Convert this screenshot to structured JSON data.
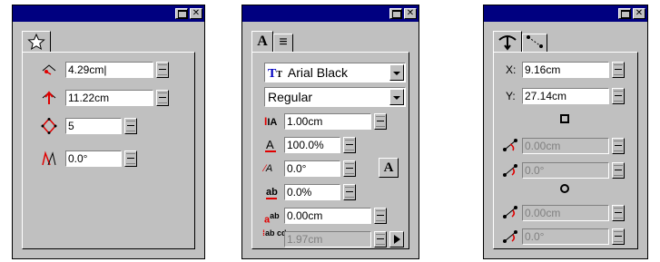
{
  "window_controls": {
    "minimize": "minimize",
    "close": "✕"
  },
  "star_panel": {
    "tab_icon": "star-icon",
    "fields": [
      {
        "icon": "star-inner-radius-icon",
        "value": "4.29cm|"
      },
      {
        "icon": "star-outer-radius-icon",
        "value": "11.22cm"
      },
      {
        "icon": "star-points-icon",
        "value": "5"
      },
      {
        "icon": "star-angle-icon",
        "value": "0.0°"
      }
    ]
  },
  "text_panel": {
    "tabs": [
      {
        "label": "A"
      },
      {
        "label": "≡"
      }
    ],
    "font_name": "Arial Black",
    "font_style": "Regular",
    "fields": [
      {
        "icon": "font-size-icon",
        "label": "IA",
        "value": "1.00cm",
        "disabled": false
      },
      {
        "icon": "horizontal-scale-icon",
        "label": "A",
        "value": "100.0%",
        "disabled": false
      },
      {
        "icon": "slant-angle-icon",
        "label": "A",
        "value": "0.0°",
        "disabled": false
      },
      {
        "icon": "character-spacing-icon",
        "label": "ab",
        "value": "0.0%",
        "disabled": false
      },
      {
        "icon": "baseline-shift-icon",
        "label": "ab",
        "value": "0.00cm",
        "disabled": false
      },
      {
        "icon": "line-spacing-icon",
        "label": "ab cd",
        "value": "1.97cm",
        "disabled": true
      }
    ],
    "font_button_label": "A"
  },
  "point_panel": {
    "tab_icons": [
      "node-edit-icon",
      "control-points-icon"
    ],
    "x_label": "X:",
    "x_value": "9.16cm",
    "y_label": "Y:",
    "y_value": "27.14cm",
    "handle_fields": [
      {
        "value": "0.00cm"
      },
      {
        "value": "0.0°"
      },
      {
        "value": "0.00cm"
      },
      {
        "value": "0.0°"
      }
    ]
  }
}
